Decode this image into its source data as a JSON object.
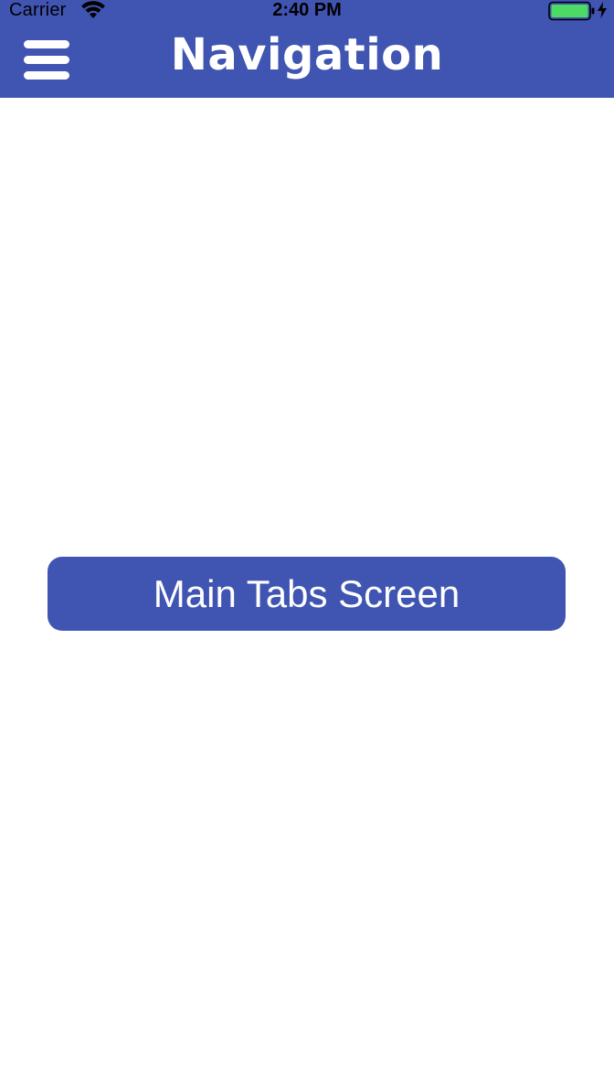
{
  "status_bar": {
    "carrier": "Carrier",
    "time": "2:40 PM",
    "wifi_icon": "wifi-icon",
    "battery_icon": "battery-icon",
    "charging_icon": "charging-bolt-icon",
    "battery_color": "#4cd964"
  },
  "nav_bar": {
    "title": "Navigation",
    "menu_icon": "hamburger-menu-icon",
    "background_color": "#4054b2"
  },
  "main": {
    "main_tabs_button_label": "Main Tabs Screen",
    "button_color": "#4054b2"
  }
}
